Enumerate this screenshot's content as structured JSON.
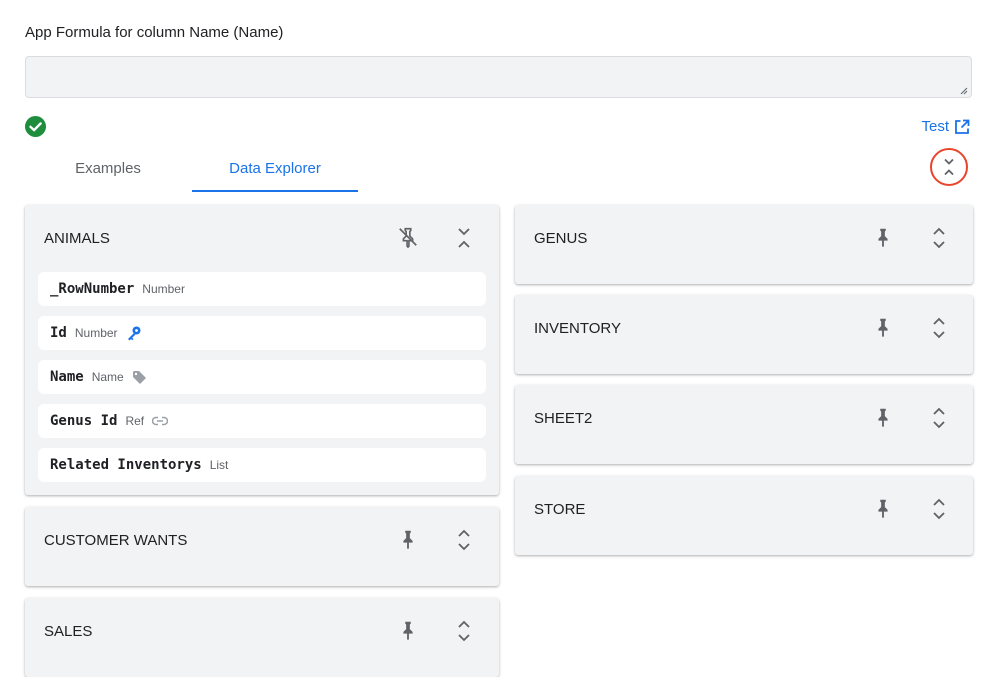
{
  "formula": {
    "label": "App Formula for column Name (Name)",
    "value": "",
    "valid_color": "#1e8e3e"
  },
  "test_link": {
    "label": "Test"
  },
  "tabs": [
    {
      "label": "Examples",
      "selected": false
    },
    {
      "label": "Data Explorer",
      "selected": true
    }
  ],
  "accent_color": "#1a73e8",
  "tables_left": [
    {
      "name": "ANIMALS",
      "expanded": true,
      "pinned": true,
      "columns": [
        {
          "name": "_RowNumber",
          "type": "Number",
          "icon": ""
        },
        {
          "name": "Id",
          "type": "Number",
          "icon": "key-icon"
        },
        {
          "name": "Name",
          "type": "Name",
          "icon": "label-icon"
        },
        {
          "name": "Genus Id",
          "type": "Ref",
          "icon": "link-icon"
        },
        {
          "name": "Related Inventorys",
          "type": "List",
          "icon": ""
        }
      ]
    },
    {
      "name": "CUSTOMER WANTS",
      "expanded": false,
      "pinned": false
    },
    {
      "name": "SALES",
      "expanded": false,
      "pinned": false
    }
  ],
  "tables_right": [
    {
      "name": "GENUS",
      "expanded": false,
      "pinned": false
    },
    {
      "name": "INVENTORY",
      "expanded": false,
      "pinned": false
    },
    {
      "name": "SHEET2",
      "expanded": false,
      "pinned": false
    },
    {
      "name": "STORE",
      "expanded": false,
      "pinned": false
    }
  ]
}
